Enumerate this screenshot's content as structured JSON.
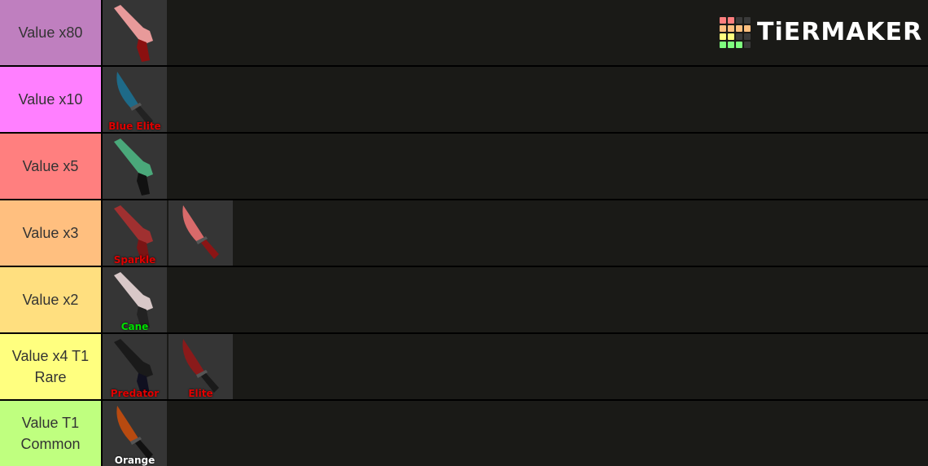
{
  "brand": {
    "name": "TiERMAKER",
    "grid_colors": [
      "#ff7f7f",
      "#ff7f7f",
      "#3a3a3a",
      "#3a3a3a",
      "#ffbf7f",
      "#ffbf7f",
      "#ffbf7f",
      "#ffbf7f",
      "#ffff7f",
      "#ffff7f",
      "#3a3a3a",
      "#3a3a3a",
      "#7fff7f",
      "#7fff7f",
      "#7fff7f",
      "#3a3a3a"
    ]
  },
  "tiers": [
    {
      "label": "Value x80",
      "color": "#bf7fbf",
      "items": [
        {
          "name": "pink-revolver",
          "caption": "",
          "caption_color": ""
        }
      ]
    },
    {
      "label": "Value x10",
      "color": "#ff7fff",
      "items": [
        {
          "name": "blue-knife",
          "caption": "Blue Elite",
          "caption_color": "#e00000"
        }
      ]
    },
    {
      "label": "Value x5",
      "color": "#ff7f7f",
      "items": [
        {
          "name": "green-blue-revolver",
          "caption": "",
          "caption_color": ""
        }
      ]
    },
    {
      "label": "Value x3",
      "color": "#ffbf7f",
      "items": [
        {
          "name": "red-revolver",
          "caption": "Sparkle",
          "caption_color": "#e00000"
        },
        {
          "name": "candy-knife",
          "caption": "",
          "caption_color": ""
        }
      ]
    },
    {
      "label": "Value x2",
      "color": "#ffdf7f",
      "items": [
        {
          "name": "cane-revolver",
          "caption": "Cane",
          "caption_color": "#00e000"
        }
      ]
    },
    {
      "label": "Value x4 T1 Rare",
      "color": "#ffff7f",
      "items": [
        {
          "name": "black-revolver",
          "caption": "Predator",
          "caption_color": "#e00000"
        },
        {
          "name": "red-knife",
          "caption": "Elite",
          "caption_color": "#e00000"
        }
      ]
    },
    {
      "label": "Value T1 Common",
      "color": "#bfff7f",
      "items": [
        {
          "name": "orange-knife",
          "caption": "Orange",
          "caption_color": "#ffffff"
        }
      ]
    }
  ]
}
